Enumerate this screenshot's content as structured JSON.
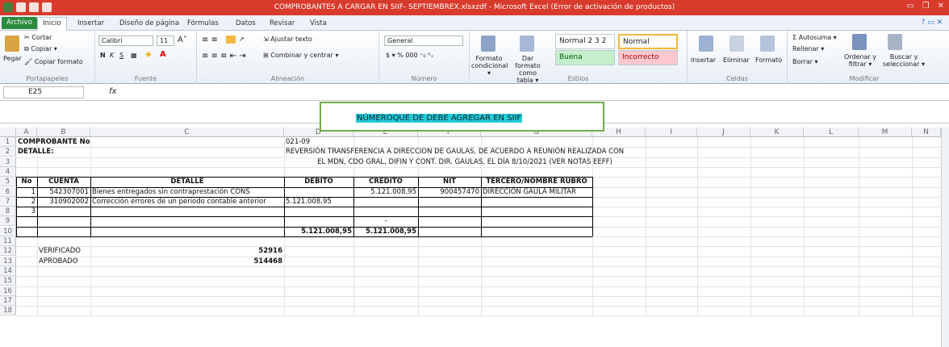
{
  "title": "COMPROBANTES A CARGAR EN SIIF- SEPTIEMBREX.xlsxzdf - Microsoft Excel (Error de activación de productos)",
  "tabs": [
    "Archivo",
    "Inicio",
    "Insertar",
    "Diseño de página",
    "Fórmulas",
    "Datos",
    "Revisar",
    "Vista"
  ],
  "ribbon": {
    "cortar": "Cortar",
    "copiar": "Copiar ▾",
    "pegar": "Pegar",
    "copiar_formato": "Copiar formato",
    "portapapeles": "Portapapeles",
    "font": "Calibri",
    "size": "11",
    "fuente": "Fuente",
    "ajustar": "Ajustar texto",
    "combinar": "Combinar y centrar ▾",
    "alineacion": "Alineación",
    "numfmt": "General",
    "numero": "Número",
    "formato_cond": "Formato condicional ▾",
    "dar_formato": "Dar formato como tabla ▾",
    "normal232": "Normal 2 3 2 ...",
    "normal": "Normal",
    "buena": "Buena",
    "incorrecto": "Incorrecto",
    "estilos": "Estilos",
    "insertar": "Insertar",
    "eliminar": "Eliminar",
    "formato": "Formato",
    "celdas": "Celdas",
    "autosuma": "Σ Autosuma ▾",
    "rellenar": "Rellenar ▾",
    "borrar": "Borrar ▾",
    "ordenar": "Ordenar y filtrar ▾",
    "buscar": "Buscar y seleccionar ▾",
    "modificar": "Modificar"
  },
  "namebox": "E25",
  "fx": "fx",
  "callout": "NÚMEROQUE DE DEBE AGREGAR EN SIIF",
  "cols": [
    "A",
    "B",
    "C",
    "D",
    "E",
    "F",
    "G",
    "H",
    "I",
    "J",
    "K",
    "L",
    "M",
    "N"
  ],
  "rows": [
    "1",
    "2",
    "3",
    "4",
    "5",
    "6",
    "7",
    "8",
    "9",
    "10",
    "11",
    "12",
    "13",
    "14",
    "15",
    "16",
    "17",
    "18"
  ],
  "cells": {
    "a1": "COMPROBANTE No",
    "d1": "021-09",
    "a2": "DETALLE:",
    "d2": "REVERSIÓN TRANSFERENCIA A DIRECCION DE GAULAS, DE ACUERDO A REUNIÓN REALIZADA CON",
    "d3": "EL MDN, CDO GRAL, DIFIN Y CONT. DIR. GAULAS, EL DÍA 8/10/2021 (VER NOTAS EEFF)",
    "h_no": "No",
    "h_cuenta": "CUENTA",
    "h_detalle": "DETALLE",
    "h_debito": "DEBITO",
    "h_credito": "CREDITO",
    "h_nit": "NIT",
    "h_tercero": "TERCERO/NOMBRE RUBRO",
    "r6_no": "1",
    "r6_cuenta": "542307001",
    "r6_det": "Bienes entregados sin contraprestación CONS",
    "r6_cred": "5.121.008,95",
    "r6_nit": "900457470",
    "r6_ter": "DIRECCIÓN GAULA MILITAR",
    "r7_no": "2",
    "r7_cuenta": "310902002",
    "r7_det": "Corrección errores de un periodo contable anterior",
    "r7_deb": "5.121.008,95",
    "r8_no": "3",
    "r9_cred": "-",
    "tot_deb": "5.121.008,95",
    "tot_cred": "5.121.008,95",
    "verificado": "VERIFICADO",
    "verificado_v": "52916",
    "aprobado": "APROBADO",
    "aprobado_v": "514468"
  }
}
